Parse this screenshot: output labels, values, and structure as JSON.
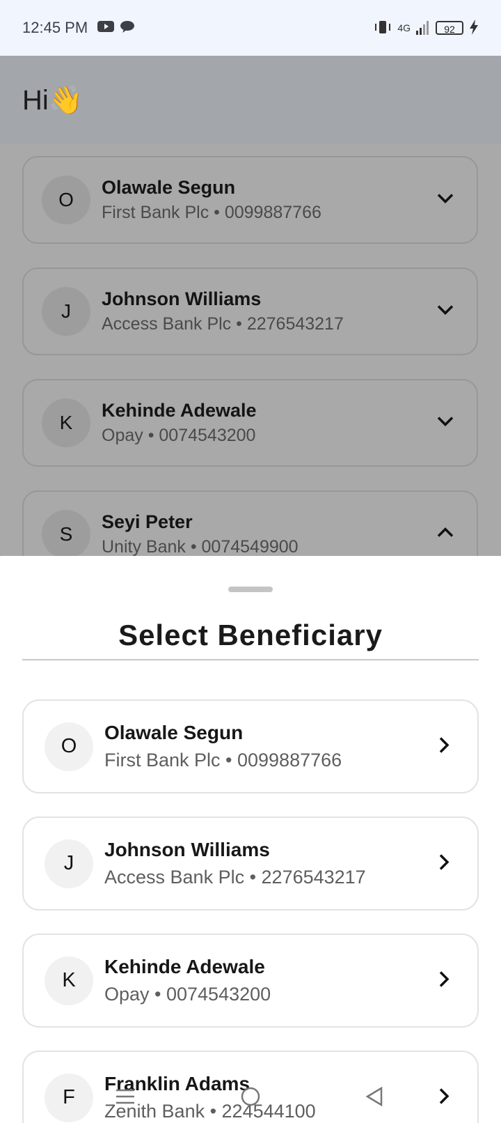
{
  "status_bar": {
    "time": "12:45 PM",
    "network": "4G",
    "battery": "92"
  },
  "home": {
    "greeting": "Hi👋",
    "beneficiaries": [
      {
        "initial": "O",
        "name": "Olawale Segun",
        "detail": "First Bank Plc • 0099887766",
        "chevron": "chevron-down-icon"
      },
      {
        "initial": "J",
        "name": "Johnson Williams",
        "detail": "Access Bank Plc • 2276543217",
        "chevron": "chevron-down-icon"
      },
      {
        "initial": "K",
        "name": "Kehinde Adewale",
        "detail": "Opay • 0074543200",
        "chevron": "chevron-down-icon"
      },
      {
        "initial": "S",
        "name": "Seyi Peter",
        "detail": "Unity Bank • 0074549900",
        "chevron": "chevron-up-icon"
      }
    ]
  },
  "sheet": {
    "title": "Select Beneficiary",
    "items": [
      {
        "initial": "O",
        "name": "Olawale Segun",
        "detail": "First Bank Plc • 0099887766"
      },
      {
        "initial": "J",
        "name": "Johnson Williams",
        "detail": "Access Bank Plc • 2276543217"
      },
      {
        "initial": "K",
        "name": "Kehinde Adewale",
        "detail": "Opay • 0074543200"
      },
      {
        "initial": "F",
        "name": "Franklin Adams",
        "detail": "Zenith Bank • 224544100"
      }
    ]
  },
  "colors": {
    "scrim": "#a9a9a9",
    "sheet_bg": "#ffffff",
    "status_bg": "#f1f5fd"
  }
}
